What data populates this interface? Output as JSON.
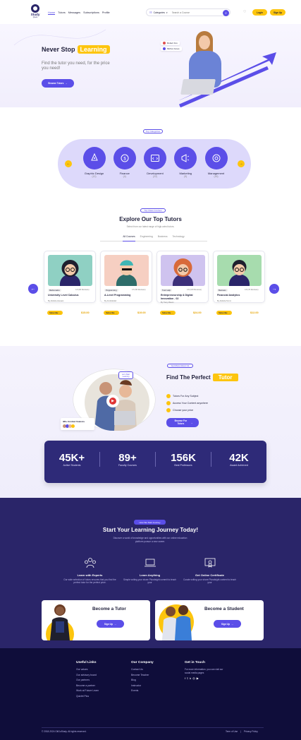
{
  "header": {
    "logo_top": "Study",
    "logo_sub": "Quest",
    "nav": [
      "Home",
      "Tutors",
      "Messages",
      "Subscriptions",
      "Profile"
    ],
    "categories_label": "Categories",
    "search_placeholder": "Search a Course",
    "login": "Login",
    "signup": "Sign Up"
  },
  "hero": {
    "title_prefix": "Never Stop",
    "title_highlight": "Learning",
    "subtitle": "Find the tutor you need, for the price you need!",
    "cta": "Browse Tutors",
    "chip1": "Robert Fox",
    "chip2": "Michel Jones"
  },
  "top_categories": {
    "badge": "Top Categories",
    "items": [
      {
        "label": "Graphic Design",
        "count": "(12)",
        "icon": "pen-tool-icon"
      },
      {
        "label": "Finance",
        "count": "(4)",
        "icon": "finance-icon"
      },
      {
        "label": "Development",
        "count": "(22)",
        "icon": "code-icon"
      },
      {
        "label": "Marketing",
        "count": "(9)",
        "icon": "megaphone-icon"
      },
      {
        "label": "Management",
        "count": "(16)",
        "icon": "management-icon"
      }
    ]
  },
  "tutors": {
    "badge": "Top Class Courses",
    "title": "Explore Our Top Tutors",
    "subtitle": "Select from our latest range of high-rated tutors.",
    "tabs": [
      "All Courses",
      "Engineering",
      "Business",
      "Technology"
    ],
    "cards": [
      {
        "tag": "Mathematics",
        "rating": "4.9 (82 Reviews)",
        "title": "University Level Calculus",
        "author": "By Abdulla Hossain",
        "price": "$15.00",
        "btn": "Subscribe",
        "bg": "#8fd0c3"
      },
      {
        "tag": "Programming",
        "rating": "4.5 (56 Reviews)",
        "title": "A-Level Programming",
        "author": "By Ali Abdullah",
        "price": "$19.00",
        "btn": "Subscribe",
        "bg": "#f6cfc2"
      },
      {
        "tag": "Tutor Help",
        "rating": "4.8 (120 Reviews)",
        "title": "Entrepreneurship & Digital Innovation - 02",
        "author": "By Tracy Mason",
        "price": "$24.00",
        "btn": "Subscribe",
        "bg": "#cfc3ef"
      },
      {
        "tag": "Business",
        "rating": "4.8 (76 Reviews)",
        "title": "Financial Analytics",
        "author": "By Abdulla Tonmi",
        "price": "$12.00",
        "btn": "Subscribe",
        "bg": "#a7dcae"
      }
    ]
  },
  "about": {
    "badge": "Get More About Us",
    "title_prefix": "Find The Perfect",
    "title_highlight": "Tutor",
    "points": [
      "Tutors For Any Subject",
      "Access Your Content anywhere",
      "Choose your price"
    ],
    "cta": "Browse For Tutors",
    "bubble": "Let's Start Learning",
    "enrolled": "386+ Enrolled Students"
  },
  "stats": [
    {
      "value": "45K+",
      "label": "Active Students"
    },
    {
      "value": "89+",
      "label": "Faculty Courses"
    },
    {
      "value": "156K",
      "label": "Best Professors"
    },
    {
      "value": "42K",
      "label": "Award Achieved"
    }
  ],
  "journey": {
    "badge": "How We Start Journey",
    "title": "Start Your Learning Journey Today!",
    "subtitle": "Discover a world of knowledge and opportunities with our online education platform pursue a new career.",
    "features": [
      {
        "title": "Learn with Experts",
        "desc": "Our wide selection of tutors ensures that you find the perfect tutor for the perfect price.",
        "icon": "experts-icon"
      },
      {
        "title": "Learn Anything",
        "desc": "Simple writing your share Pluralsight commit to teach your",
        "icon": "laptop-icon"
      },
      {
        "title": "Get Online Certificate",
        "desc": "Curate writing your share Pluralsight content to teach your",
        "icon": "certificate-icon"
      }
    ],
    "become_tutor": "Become a Tutor",
    "become_student": "Become a Student",
    "signup": "Sign Up"
  },
  "footer": {
    "useful_title": "Useful Links",
    "useful": [
      "Our values",
      "Our advisory board",
      "Our partners",
      "Become a partner",
      "Work at Future Learn",
      "Quizlet Plus"
    ],
    "company_title": "Our Company",
    "company": [
      "Contact Us",
      "Become Teacher",
      "Blog",
      "Instructor",
      "Events"
    ],
    "touch_title": "Get in Touch",
    "touch_desc": "For more information, you can visit our social media pages",
    "copyright": "© 2018-2024 GitGuStudy. All rights reserved.",
    "terms": "Term of Use",
    "privacy": "Privacy Policy"
  },
  "colors": {
    "accent": "#5b4ee8",
    "yellow": "#fdc50e",
    "navy": "#2a2569",
    "footer": "#0f0d3a"
  }
}
